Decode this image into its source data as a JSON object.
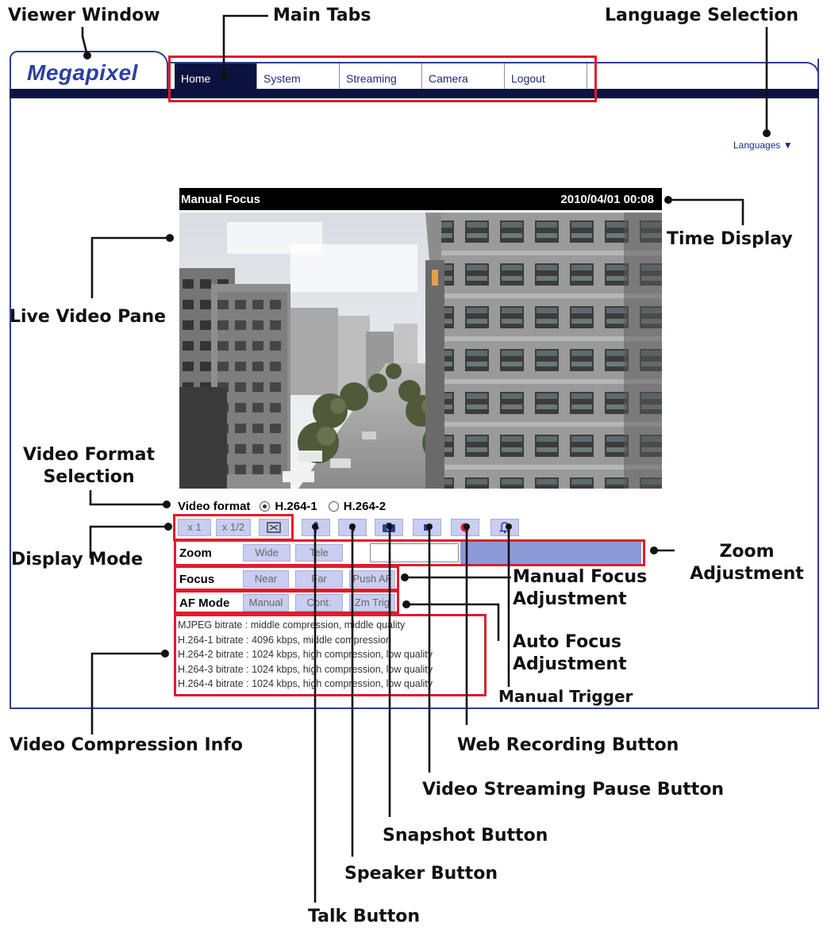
{
  "callouts": {
    "viewer_window": "Viewer Window",
    "main_tabs": "Main Tabs",
    "language_selection": "Language Selection",
    "time_display": "Time Display",
    "live_video_pane": "Live Video Pane",
    "video_format_selection": "Video Format Selection",
    "display_mode": "Display Mode",
    "zoom_adjustment": "Zoom Adjustment",
    "manual_focus_adjustment": "Manual Focus Adjustment",
    "auto_focus_adjustment": "Auto Focus Adjustment",
    "manual_trigger": "Manual Trigger",
    "video_compression_info": "Video Compression Info",
    "web_recording_button": "Web Recording Button",
    "video_streaming_pause_button": "Video Streaming Pause Button",
    "snapshot_button": "Snapshot Button",
    "speaker_button": "Speaker Button",
    "talk_button": "Talk Button"
  },
  "app": {
    "logo": "Megapixel",
    "tabs": [
      "Home",
      "System",
      "Streaming",
      "Camera",
      "Logout"
    ],
    "languages_link": "Languages ▼"
  },
  "video": {
    "title": "Manual Focus",
    "datetime": "2010/04/01 00:08"
  },
  "video_format": {
    "label": "Video format",
    "options": [
      "H.264-1",
      "H.264-2"
    ],
    "selected": "H.264-1"
  },
  "display_mode": {
    "buttons": [
      "x 1",
      "x 1/2"
    ]
  },
  "zoom": {
    "label": "Zoom",
    "wide": "Wide",
    "tele": "Tele"
  },
  "focus": {
    "label": "Focus",
    "near": "Near",
    "far": "Far",
    "push_af": "Push AF"
  },
  "af_mode": {
    "label": "AF Mode",
    "manual": "Manual",
    "cont": "Cont.",
    "zm_trig": "Zm Trig"
  },
  "bitrate_info": [
    "MJPEG bitrate : middle compression, middle quality",
    "H.264-1 bitrate : 4096 kbps, middle compression",
    "H.264-2 bitrate : 1024 kbps, high compression, low quality",
    "H.264-3 bitrate : 1024 kbps, high compression, low quality",
    "H.264-4 bitrate : 1024 kbps, high compression, low quality"
  ],
  "colors": {
    "highlight_red": "#e21b2b",
    "navy": "#0d1340",
    "brand_blue": "#2a3fa0",
    "button_fill": "#c9cdf0",
    "slider_fill": "#8c9ad6"
  },
  "icons": {
    "talk": "microphone-icon",
    "speaker": "speaker-icon",
    "snapshot": "camera-icon",
    "pause": "stop-square-icon",
    "record": "record-dot-icon",
    "trigger": "bell-icon",
    "fullscreen": "fullscreen-icon"
  }
}
